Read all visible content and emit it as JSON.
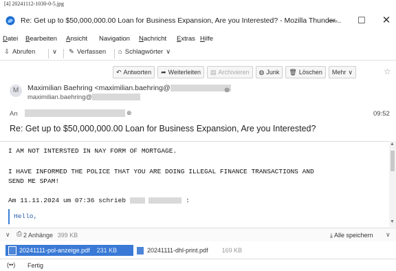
{
  "file_caption": "[4] 20241112-1030-0-5.jpg",
  "window": {
    "title": "Re: Get up to $50,000,000.00 Loan for Business Expansion, Are you Interested? - Mozilla Thunder...",
    "minimize": "—",
    "maximize": "☐",
    "close": "✕"
  },
  "menu": {
    "items": [
      {
        "u": "D",
        "rest": "atei"
      },
      {
        "u": "B",
        "rest": "earbeiten"
      },
      {
        "u": "A",
        "rest": "nsicht"
      },
      {
        "u": "Nav",
        "rest": "igation"
      },
      {
        "u": "N",
        "rest": "achricht"
      },
      {
        "u": "E",
        "rest": "xtras"
      },
      {
        "u": "H",
        "rest": "ilfe"
      }
    ]
  },
  "toolbar": {
    "get_mail": "Abrufen",
    "write": "Verfassen",
    "tags": "Schlagwörter"
  },
  "actions": {
    "reply": "Antworten",
    "forward": "Weiterleiten",
    "archive": "Archivieren",
    "junk": "Junk",
    "delete": "Löschen",
    "more": "Mehr"
  },
  "header": {
    "avatar_initial": "M",
    "from_name": "Maximilian Baehring <maximilian.baehring@",
    "from_line2": "maximilian.baehring@",
    "to_label": "An",
    "time": "09:52",
    "subject": "Re: Get up to $50,000,000.00 Loan for Business Expansion, Are you Interested?"
  },
  "body": {
    "line1": "I AM NOT INTERSTED IN NAY FORM OF MORTGAGE.",
    "line2": "I HAVE INFORMED THE POLICE THAT YOU ARE DOING ILLEGAL FINANCE TRANSACTIONS AND",
    "line3": "SEND ME SPAM!",
    "quote_intro": "Am 11.11.2024 um 07:36 schrieb",
    "quote_intro_end": ":",
    "quote_text": "Hello,"
  },
  "attachments": {
    "count_label": "2 Anhänge",
    "total_size": "399 KB",
    "save_all": "Alle speichern",
    "files": [
      {
        "name": "20241111-pol-anzeige.pdf",
        "size": "231 KB"
      },
      {
        "name": "20241111-dhl-print.pdf",
        "size": "169 KB"
      }
    ]
  },
  "status": {
    "text": "Fertig"
  },
  "colors": {
    "accent": "#3a7ad6",
    "quote": "#2c5ea8"
  }
}
